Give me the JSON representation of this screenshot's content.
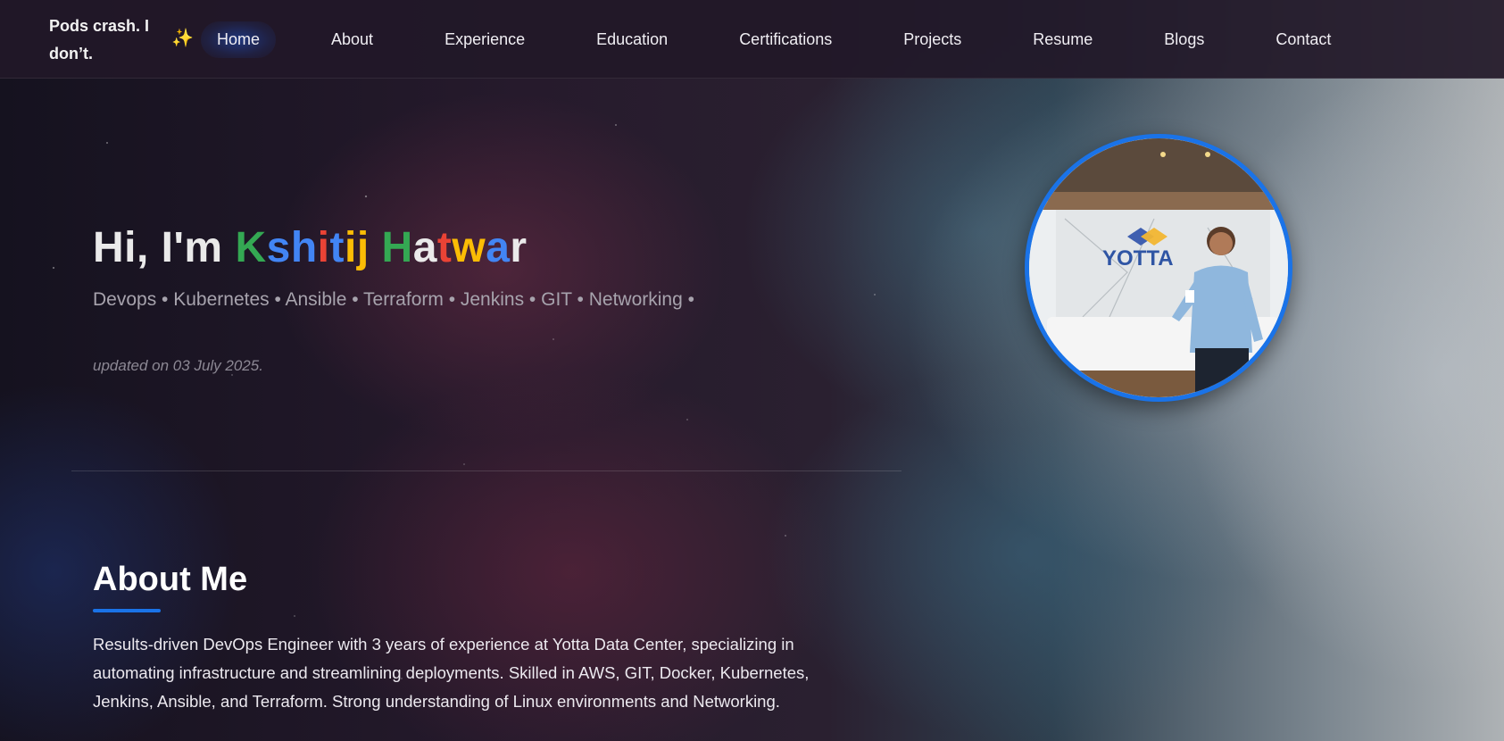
{
  "navbar": {
    "brand": "Pods crash. I don’t.",
    "brand_icon": "sparkles-icon",
    "links": [
      "Home",
      "About",
      "Experience",
      "Education",
      "Certifications",
      "Projects",
      "Resume",
      "Blogs",
      "Contact"
    ],
    "active": "Home"
  },
  "hero": {
    "greeting": "Hi, I'm",
    "name_letters": [
      {
        "ch": "K",
        "color": "#34a853"
      },
      {
        "ch": "s",
        "color": "#4285f4"
      },
      {
        "ch": "h",
        "color": "#4285f4"
      },
      {
        "ch": "i",
        "color": "#ea4335"
      },
      {
        "ch": "t",
        "color": "#4285f4"
      },
      {
        "ch": "i",
        "color": "#fbbc05"
      },
      {
        "ch": "j",
        "color": "#fbbc05"
      },
      {
        "ch": " ",
        "color": "#ffffff"
      },
      {
        "ch": "H",
        "color": "#34a853"
      },
      {
        "ch": "a",
        "color": "#eaeaea"
      },
      {
        "ch": "t",
        "color": "#ea4335"
      },
      {
        "ch": "w",
        "color": "#fbbc05"
      },
      {
        "ch": "a",
        "color": "#4285f4"
      },
      {
        "ch": "r",
        "color": "#eaeaea"
      }
    ],
    "skills": "Devops • Kubernetes • Ansible • Terraform • Jenkins • GIT • Networking •",
    "updated": "updated on 03 July 2025."
  },
  "profile": {
    "logo_text": "YOTTA",
    "border_color": "#1a73e8"
  },
  "about": {
    "heading": "About Me",
    "text": "Results-driven DevOps Engineer with 3 years of experience at Yotta Data Center, specializing in automating infrastructure and streamlining deployments. Skilled in AWS, GIT, Docker, Kubernetes, Jenkins, Ansible, and Terraform. Strong understanding of Linux environments and Networking."
  }
}
